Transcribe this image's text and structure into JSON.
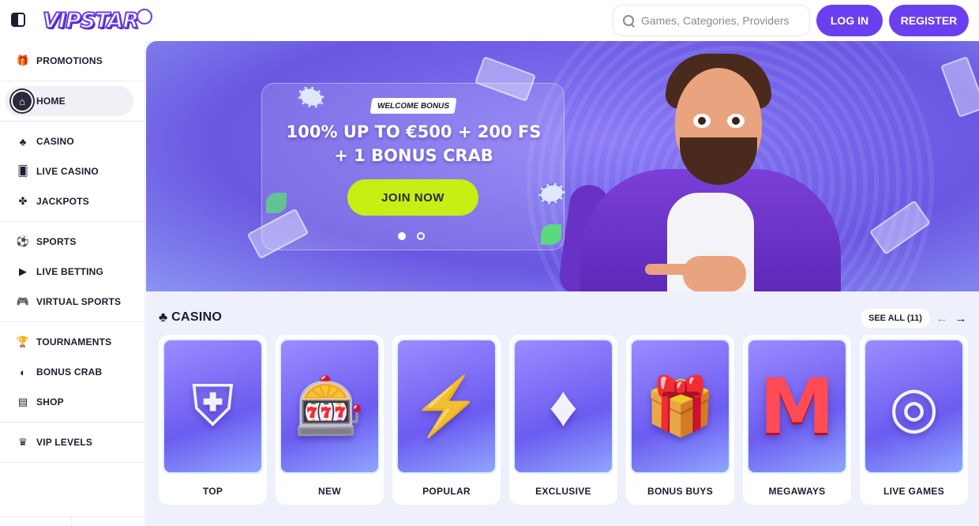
{
  "header": {
    "logo_text": "VIPSTAR",
    "search_placeholder": "Games, Categories, Providers",
    "login_label": "LOG IN",
    "register_label": "REGISTER"
  },
  "sidebar": {
    "groups": [
      [
        {
          "label": "PROMOTIONS",
          "icon": "gift-icon"
        }
      ],
      [
        {
          "label": "HOME",
          "icon": "home-icon",
          "active": true
        }
      ],
      [
        {
          "label": "CASINO",
          "icon": "cherry-icon"
        },
        {
          "label": "LIVE CASINO",
          "icon": "cards-icon"
        },
        {
          "label": "JACKPOTS",
          "icon": "clover-icon"
        }
      ],
      [
        {
          "label": "SPORTS",
          "icon": "soccer-ball-icon"
        },
        {
          "label": "LIVE BETTING",
          "icon": "play-icon"
        },
        {
          "label": "VIRTUAL SPORTS",
          "icon": "gamepad-icon"
        }
      ],
      [
        {
          "label": "TOURNAMENTS",
          "icon": "trophy-icon"
        },
        {
          "label": "BONUS CRAB",
          "icon": "crab-icon"
        },
        {
          "label": "SHOP",
          "icon": "shop-icon"
        }
      ],
      [
        {
          "label": "VIP LEVELS",
          "icon": "crown-icon"
        }
      ]
    ]
  },
  "banner": {
    "tag": "WELCOME BONUS",
    "headline_line1": "100% UP TO €500 + 200 FS",
    "headline_line2": "+ 1 BONUS CRAB",
    "cta_label": "JOIN NOW",
    "slides_total": 2,
    "active_slide": 1
  },
  "casino": {
    "title": "CASINO",
    "see_all_label": "SEE ALL (11)",
    "categories": [
      {
        "label": "TOP",
        "art": "viking-warrior"
      },
      {
        "label": "NEW",
        "art": "slot-machine"
      },
      {
        "label": "POPULAR",
        "art": "zeus"
      },
      {
        "label": "EXCLUSIVE",
        "art": "diamond-crown"
      },
      {
        "label": "BONUS BUYS",
        "art": "gift-box"
      },
      {
        "label": "MEGAWAYS",
        "art": "letter-m"
      },
      {
        "label": "LIVE GAMES",
        "art": "roulette-wheel"
      }
    ]
  },
  "colors": {
    "brand": "#6a3ff0",
    "cta": "#c6ef13",
    "page_bg": "#eef0fb"
  }
}
